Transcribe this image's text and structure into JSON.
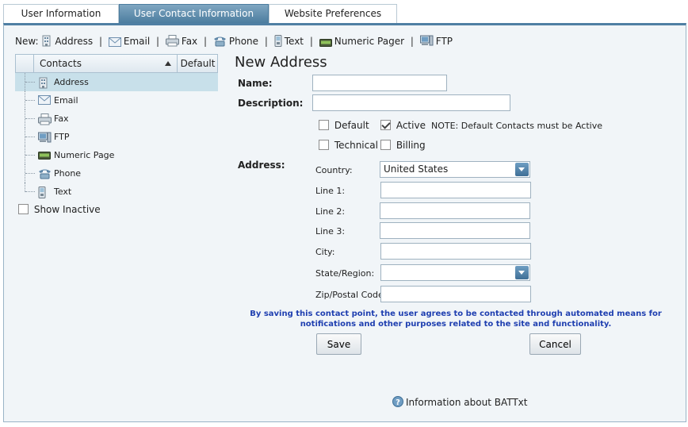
{
  "tabs": [
    {
      "label": "User Information"
    },
    {
      "label": "User Contact Information"
    },
    {
      "label": "Website Preferences"
    }
  ],
  "new_bar": {
    "prefix": "New:",
    "separator": "|",
    "items": [
      {
        "label": "Address",
        "icon": "building-icon"
      },
      {
        "label": "Email",
        "icon": "envelope-icon"
      },
      {
        "label": "Fax",
        "icon": "fax-icon"
      },
      {
        "label": "Phone",
        "icon": "phone-icon"
      },
      {
        "label": "Text",
        "icon": "mobile-icon"
      },
      {
        "label": "Numeric Pager",
        "icon": "pager-icon"
      },
      {
        "label": "FTP",
        "icon": "computer-icon"
      }
    ]
  },
  "contacts_tree": {
    "col_contacts": "Contacts",
    "col_default": "Default",
    "rows": [
      {
        "label": "Address",
        "icon": "building-icon",
        "selected": true
      },
      {
        "label": "Email",
        "icon": "envelope-icon"
      },
      {
        "label": "Fax",
        "icon": "fax-icon"
      },
      {
        "label": "FTP",
        "icon": "computer-icon"
      },
      {
        "label": "Numeric Page",
        "icon": "pager-icon"
      },
      {
        "label": "Phone",
        "icon": "phone-icon"
      },
      {
        "label": "Text",
        "icon": "mobile-icon"
      }
    ],
    "show_inactive_label": "Show Inactive",
    "show_inactive_checked": false
  },
  "form": {
    "title": "New Address",
    "name_label": "Name:",
    "name_value": "",
    "description_label": "Description:",
    "description_value": "",
    "flags": {
      "default_label": "Default",
      "default_checked": false,
      "active_label": "Active",
      "active_checked": true,
      "note": "NOTE: Default Contacts must be Active",
      "technical_label": "Technical",
      "technical_checked": false,
      "billing_label": "Billing",
      "billing_checked": false
    },
    "address_label": "Address:",
    "country_label": "Country:",
    "country_value": "United States",
    "line1_label": "Line 1:",
    "line2_label": "Line 2:",
    "line3_label": "Line 3:",
    "city_label": "City:",
    "state_label": "State/Region:",
    "state_value": "",
    "zip_label": "Zip/Postal Code:",
    "notice": "By saving this contact point, the user agrees to be contacted through automated means for notifications and other purposes related to the site and functionality.",
    "save_label": "Save",
    "cancel_label": "Cancel"
  },
  "info_link": "Information about BATTxt",
  "colors": {
    "tab_active": "#4c7d9f",
    "notice": "#1f3fb0",
    "selected_row": "#c8e0ea"
  }
}
